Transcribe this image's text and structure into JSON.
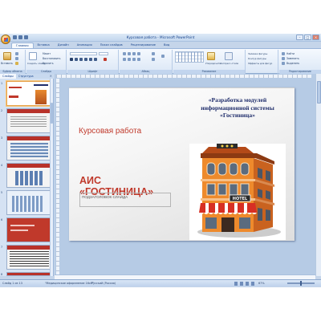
{
  "window": {
    "title": "Курсовая работа - Microsoft PowerPoint",
    "controls": [
      "–",
      "□",
      "×"
    ]
  },
  "ribbon_tabs": [
    "Главная",
    "Вставка",
    "Дизайн",
    "Анимация",
    "Показ слайдов",
    "Рецензирование",
    "Вид"
  ],
  "ribbon": {
    "clipboard": {
      "label": "Буфер обмена",
      "paste": "Вставить"
    },
    "slides": {
      "label": "Слайды",
      "create": "Создать слайд",
      "layout": "Макет",
      "restore": "Восстановить",
      "delete": "Удалить"
    },
    "font": {
      "label": "Шрифт"
    },
    "paragraph": {
      "label": "Абзац"
    },
    "drawing": {
      "label": "Рисование",
      "arrange": "Упорядочить",
      "styles": "Экспресс-стили"
    },
    "shape": {
      "fill": "Заливка фигуры",
      "outline": "Контур фигуры",
      "effects": "Эффекты для фигур"
    },
    "editing": {
      "label": "Редактирование",
      "find": "Найти",
      "replace": "Заменить",
      "select": "Выделить"
    }
  },
  "pane": {
    "tabs": [
      "Слайды",
      "Структура"
    ],
    "close": "×",
    "slide_numbers": [
      "1",
      "2",
      "3",
      "4",
      "5",
      "6",
      "7",
      "8"
    ]
  },
  "slide": {
    "left_title": "Курсовая работа",
    "right_title": "«Разработка модулей информационной системы «Гостиница»",
    "ais_line1": "АИС",
    "ais_line2": "«ГОСТИНИЦА»",
    "subtitle_placeholder": "ПОДЗАГОЛОВОК СЛАЙДА",
    "hotel_sign": "HOTEL"
  },
  "status": {
    "slide_info": "Слайд 1 из 13",
    "theme": "\"Медицинское оформление 16x9\"",
    "language": "Русский (Россия)",
    "zoom": "67%"
  },
  "colors": {
    "accent_red": "#c0392b",
    "title_navy": "#1f2d6b",
    "ribbon_blue": "#c5d5ea"
  }
}
